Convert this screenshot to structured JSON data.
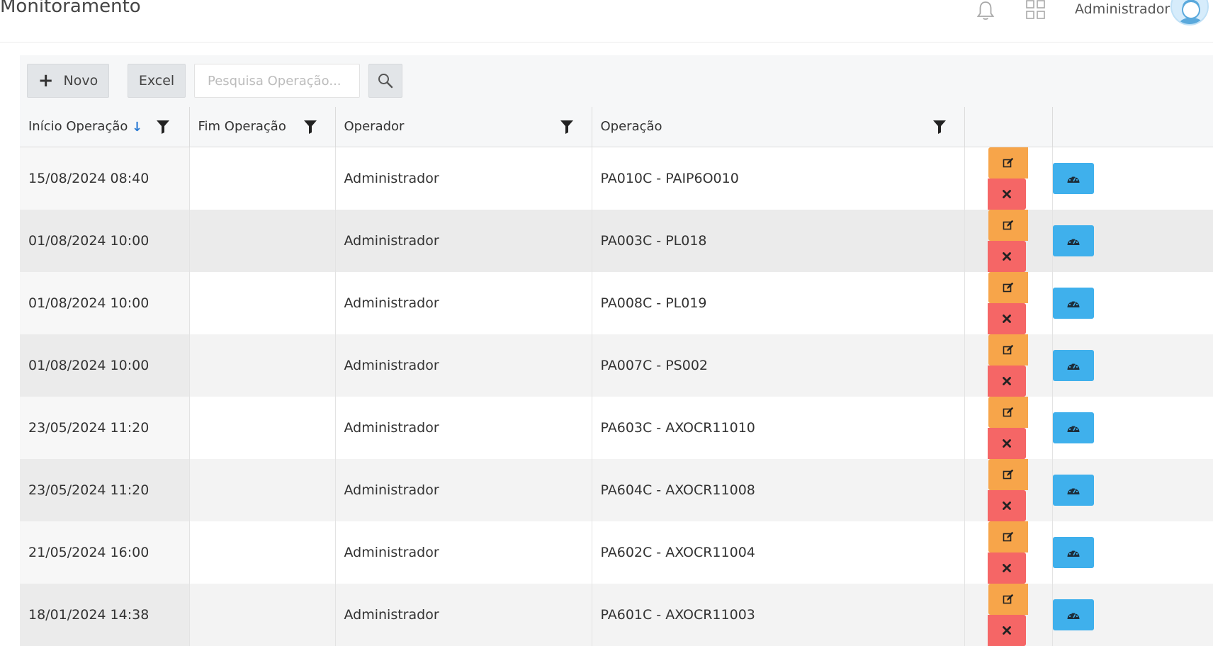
{
  "header": {
    "title": "Monitoramento",
    "user_name": "Administrador"
  },
  "toolbar": {
    "new_label": "Novo",
    "excel_label": "Excel",
    "search_placeholder": "Pesquisa Operação..."
  },
  "table": {
    "columns": [
      "Início Operação",
      "Fim Operação",
      "Operador",
      "Operação"
    ],
    "sort_column": "Início Operação",
    "sort_direction": "descending",
    "rows": [
      {
        "inicio": "15/08/2024 08:40",
        "fim": "",
        "operador": "Administrador",
        "operacao": "PA010C - PAIP6O010"
      },
      {
        "inicio": "01/08/2024 10:00",
        "fim": "",
        "operador": "Administrador",
        "operacao": "PA003C - PL018"
      },
      {
        "inicio": "01/08/2024 10:00",
        "fim": "",
        "operador": "Administrador",
        "operacao": "PA008C - PL019"
      },
      {
        "inicio": "01/08/2024 10:00",
        "fim": "",
        "operador": "Administrador",
        "operacao": "PA007C - PS002"
      },
      {
        "inicio": "23/05/2024 11:20",
        "fim": "",
        "operador": "Administrador",
        "operacao": "PA603C - AXOCR11010"
      },
      {
        "inicio": "23/05/2024 11:20",
        "fim": "",
        "operador": "Administrador",
        "operacao": "PA604C - AXOCR11008"
      },
      {
        "inicio": "21/05/2024 16:00",
        "fim": "",
        "operador": "Administrador",
        "operacao": "PA602C - AXOCR11004"
      },
      {
        "inicio": "18/01/2024 14:38",
        "fim": "",
        "operador": "Administrador",
        "operacao": "PA601C - AXOCR11003"
      }
    ]
  },
  "colors": {
    "edit": "#f7a54a",
    "delete": "#f56666",
    "dashboard": "#3fb0ec",
    "sort_arrow": "#2b7bd3"
  },
  "icons": {
    "notification": "bell-icon",
    "apps": "grid-icon",
    "search": "search-icon",
    "edit": "edit-icon",
    "delete": "close-icon",
    "dashboard": "dashboard-icon",
    "filter": "filter-icon"
  }
}
